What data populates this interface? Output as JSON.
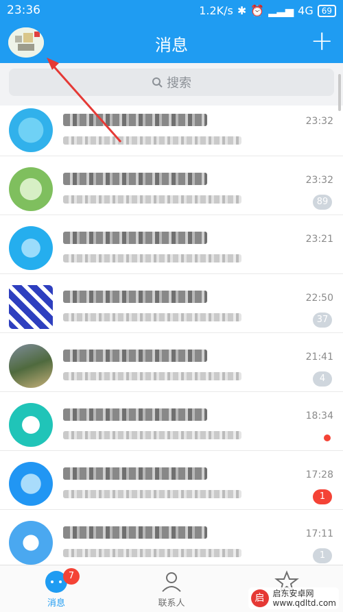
{
  "status": {
    "time": "23:36",
    "speed": "1.2K/s",
    "network": "4G",
    "battery": "69"
  },
  "header": {
    "title": "消息"
  },
  "search": {
    "placeholder": "搜索"
  },
  "conversations": [
    {
      "time": "23:32",
      "badge": ""
    },
    {
      "time": "23:32",
      "badge": "89"
    },
    {
      "time": "23:21",
      "badge": ""
    },
    {
      "time": "22:50",
      "badge": "37"
    },
    {
      "time": "21:41",
      "badge": "4"
    },
    {
      "time": "18:34",
      "badge": ""
    },
    {
      "time": "17:28",
      "badge": "1"
    },
    {
      "time": "17:11",
      "badge": "1"
    }
  ],
  "tabs": {
    "messages": "消息",
    "messages_badge": "7",
    "contacts": "联系人"
  },
  "watermark": {
    "name": "启东安卓网",
    "url": "www.qdltd.com"
  },
  "colors": {
    "brand": "#1f9cf2",
    "badge_red": "#f44336",
    "badge_gray": "#cfd6dd"
  }
}
